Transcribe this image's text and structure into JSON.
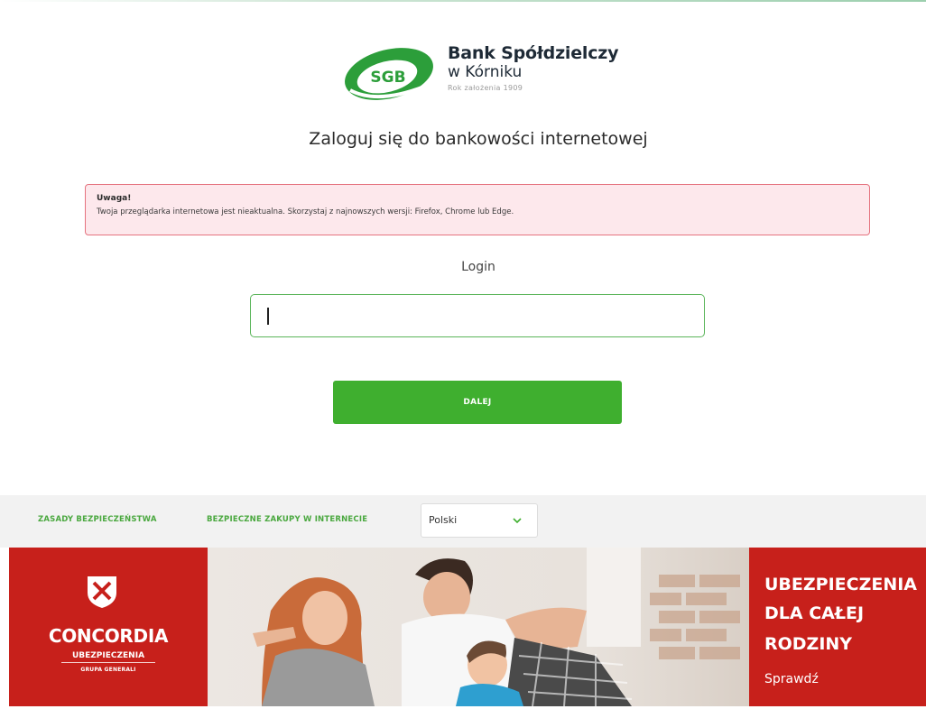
{
  "logo": {
    "mark_text": "SGB",
    "bank_name": "Bank Spółdzielczy",
    "bank_city": "w Kórniku",
    "founded": "Rok założenia 1909"
  },
  "login": {
    "heading": "Zaloguj się do bankowości internetowej",
    "label": "Login",
    "input_value": "",
    "submit_label": "DALEJ"
  },
  "alert": {
    "title": "Uwaga!",
    "message": "Twoja przeglądarka internetowa jest nieaktualna. Skorzystaj z najnowszych wersji: Firefox, Chrome lub Edge."
  },
  "footer": {
    "links": [
      "ZASADY BEZPIECZEŃSTWA",
      "BEZPIECZNE ZAKUPY W INTERNECIE"
    ],
    "language": "Polski"
  },
  "banner": {
    "brand": "CONCORDIA",
    "brand_sub": "UBEZPIECZENIA",
    "brand_sub2": "GRUPA GENERALI",
    "headline": [
      "UBEZPIECZENIA",
      "DLA CAŁEJ",
      "RODZINY"
    ],
    "cta": "Sprawdź"
  },
  "colors": {
    "brand_green": "#3faf2f",
    "alert_bg": "#fde8ec",
    "alert_border": "#e5737f",
    "banner_red": "#c7201b"
  },
  "icons": [
    "sgb-logo-mark",
    "caret-cursor",
    "chevron-down-icon",
    "concordia-crest-icon"
  ]
}
